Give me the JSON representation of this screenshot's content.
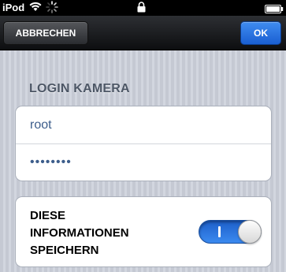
{
  "status_bar": {
    "carrier": "iPod",
    "wifi_icon": "wifi-icon",
    "activity_icon": "activity-spinner-icon",
    "lock_icon": "lock-icon",
    "battery_icon": "battery-icon"
  },
  "nav": {
    "cancel_label": "ABBRECHEN",
    "ok_label": "OK",
    "ok_color": "#2e7ae6"
  },
  "login_section": {
    "header": "LOGIN KAMERA",
    "username_value": "root",
    "password_value": "••••••••"
  },
  "save_section": {
    "label_lines": [
      "DIESE",
      "INFORMATIONEN",
      "SPEICHERN"
    ],
    "toggle_on": true,
    "toggle_color": "#2e7ae6"
  }
}
